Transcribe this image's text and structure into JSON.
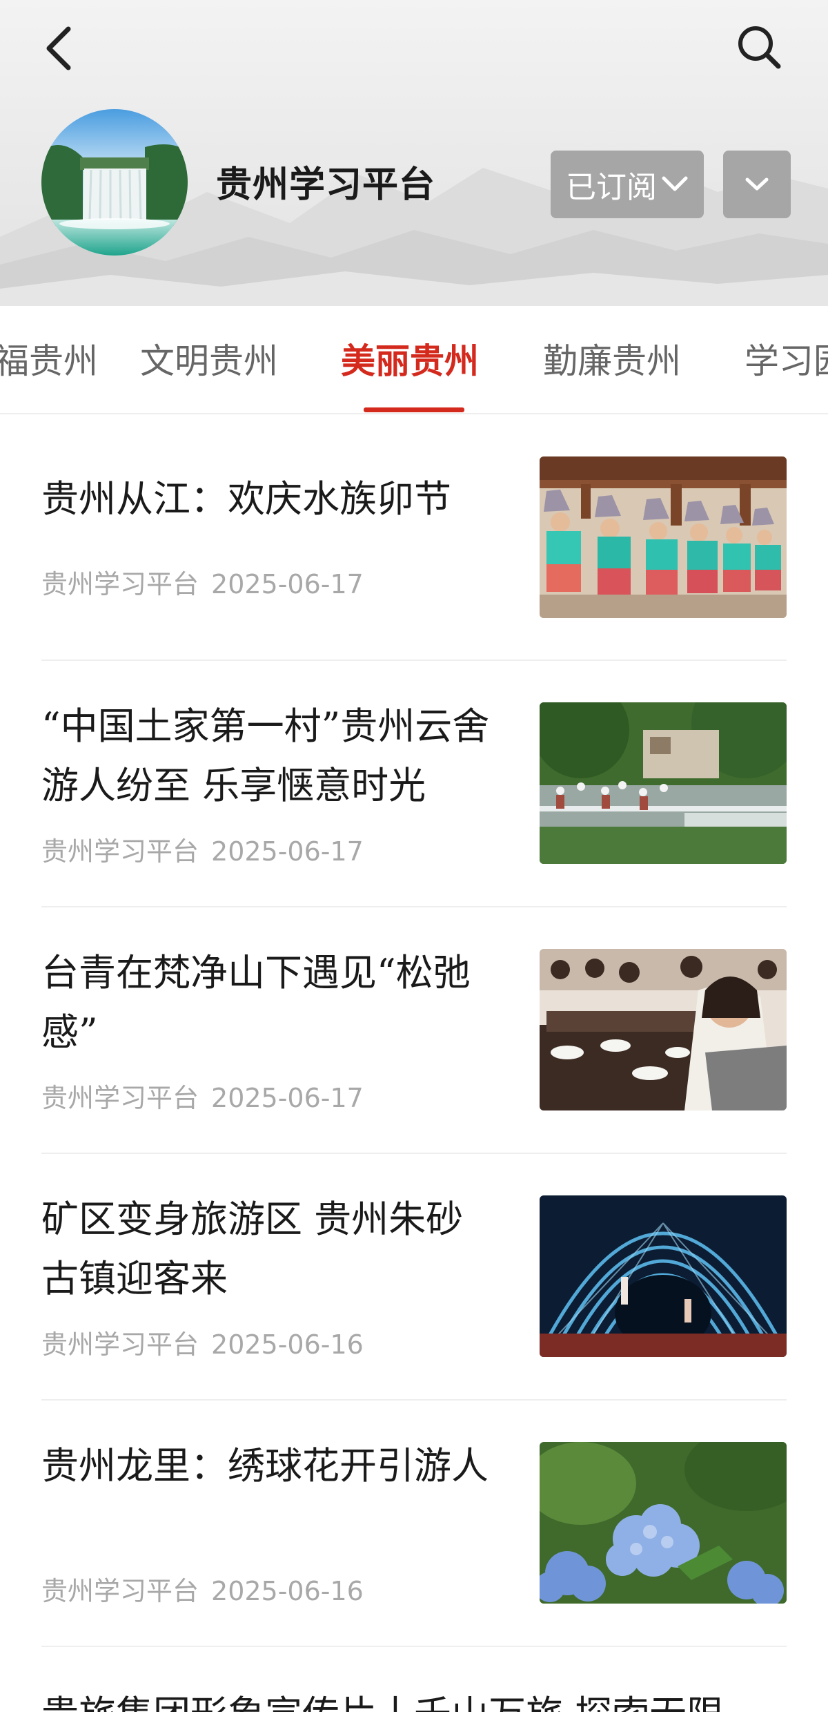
{
  "header": {
    "channel_name": "贵州学习平台",
    "subscribe_label": "已订阅"
  },
  "tabs": [
    {
      "label": "福贵州"
    },
    {
      "label": "文明贵州"
    },
    {
      "label": "美丽贵州"
    },
    {
      "label": "勤廉贵州"
    },
    {
      "label": "学习园"
    }
  ],
  "active_tab": "美丽贵州",
  "news": [
    {
      "title": "贵州从江：欢庆水族卯节",
      "source": "贵州学习平台",
      "date": "2025-06-17"
    },
    {
      "title": "“中国土家第一村”贵州云舍游人纷至 乐享惬意时光",
      "source": "贵州学习平台",
      "date": "2025-06-17"
    },
    {
      "title": "台青在梵净山下遇见“松弛感”",
      "source": "贵州学习平台",
      "date": "2025-06-17"
    },
    {
      "title": "矿区变身旅游区 贵州朱砂古镇迎客来",
      "source": "贵州学习平台",
      "date": "2025-06-16"
    },
    {
      "title": "贵州龙里：绣球花开引游人",
      "source": "贵州学习平台",
      "date": "2025-06-16"
    }
  ],
  "partial_news_title": "贵旅集团形象宣传片丨千山万旅 探索无限",
  "icons": {
    "back": "chevron-left-icon",
    "search": "search-icon",
    "subscribe_dropdown": "chevron-down-icon",
    "more": "chevron-down-icon"
  },
  "colors": {
    "accent": "#d42a1e",
    "button_gray": "#a6a6a6",
    "meta_text": "#a8a8a8"
  }
}
